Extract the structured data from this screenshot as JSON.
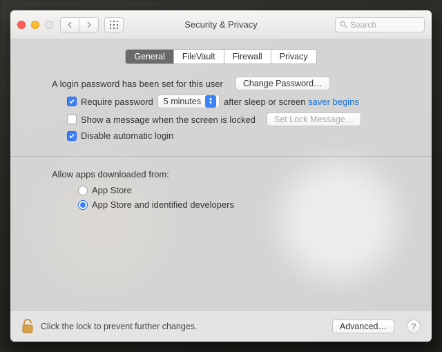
{
  "window": {
    "title": "Security & Privacy",
    "search_placeholder": "Search"
  },
  "tabs": {
    "items": [
      "General",
      "FileVault",
      "Firewall",
      "Privacy"
    ],
    "active_index": 0
  },
  "login_section": {
    "password_set_text": "A login password has been set for this user",
    "change_password_btn": "Change Password…",
    "require_password_checked": true,
    "require_password_label": "Require password",
    "require_password_delay": "5 minutes",
    "require_password_suffix_plain": "after sleep or screen ",
    "require_password_suffix_link": "saver begins",
    "show_message_checked": false,
    "show_message_label": "Show a message when the screen is locked",
    "set_lock_message_btn": "Set Lock Message…",
    "disable_auto_login_checked": true,
    "disable_auto_login_label": "Disable automatic login"
  },
  "allow_apps": {
    "heading": "Allow apps downloaded from:",
    "options": [
      "App Store",
      "App Store and identified developers"
    ],
    "selected_index": 1
  },
  "footer": {
    "lock_text": "Click the lock to prevent further changes.",
    "advanced_btn": "Advanced…",
    "help_label": "?"
  }
}
